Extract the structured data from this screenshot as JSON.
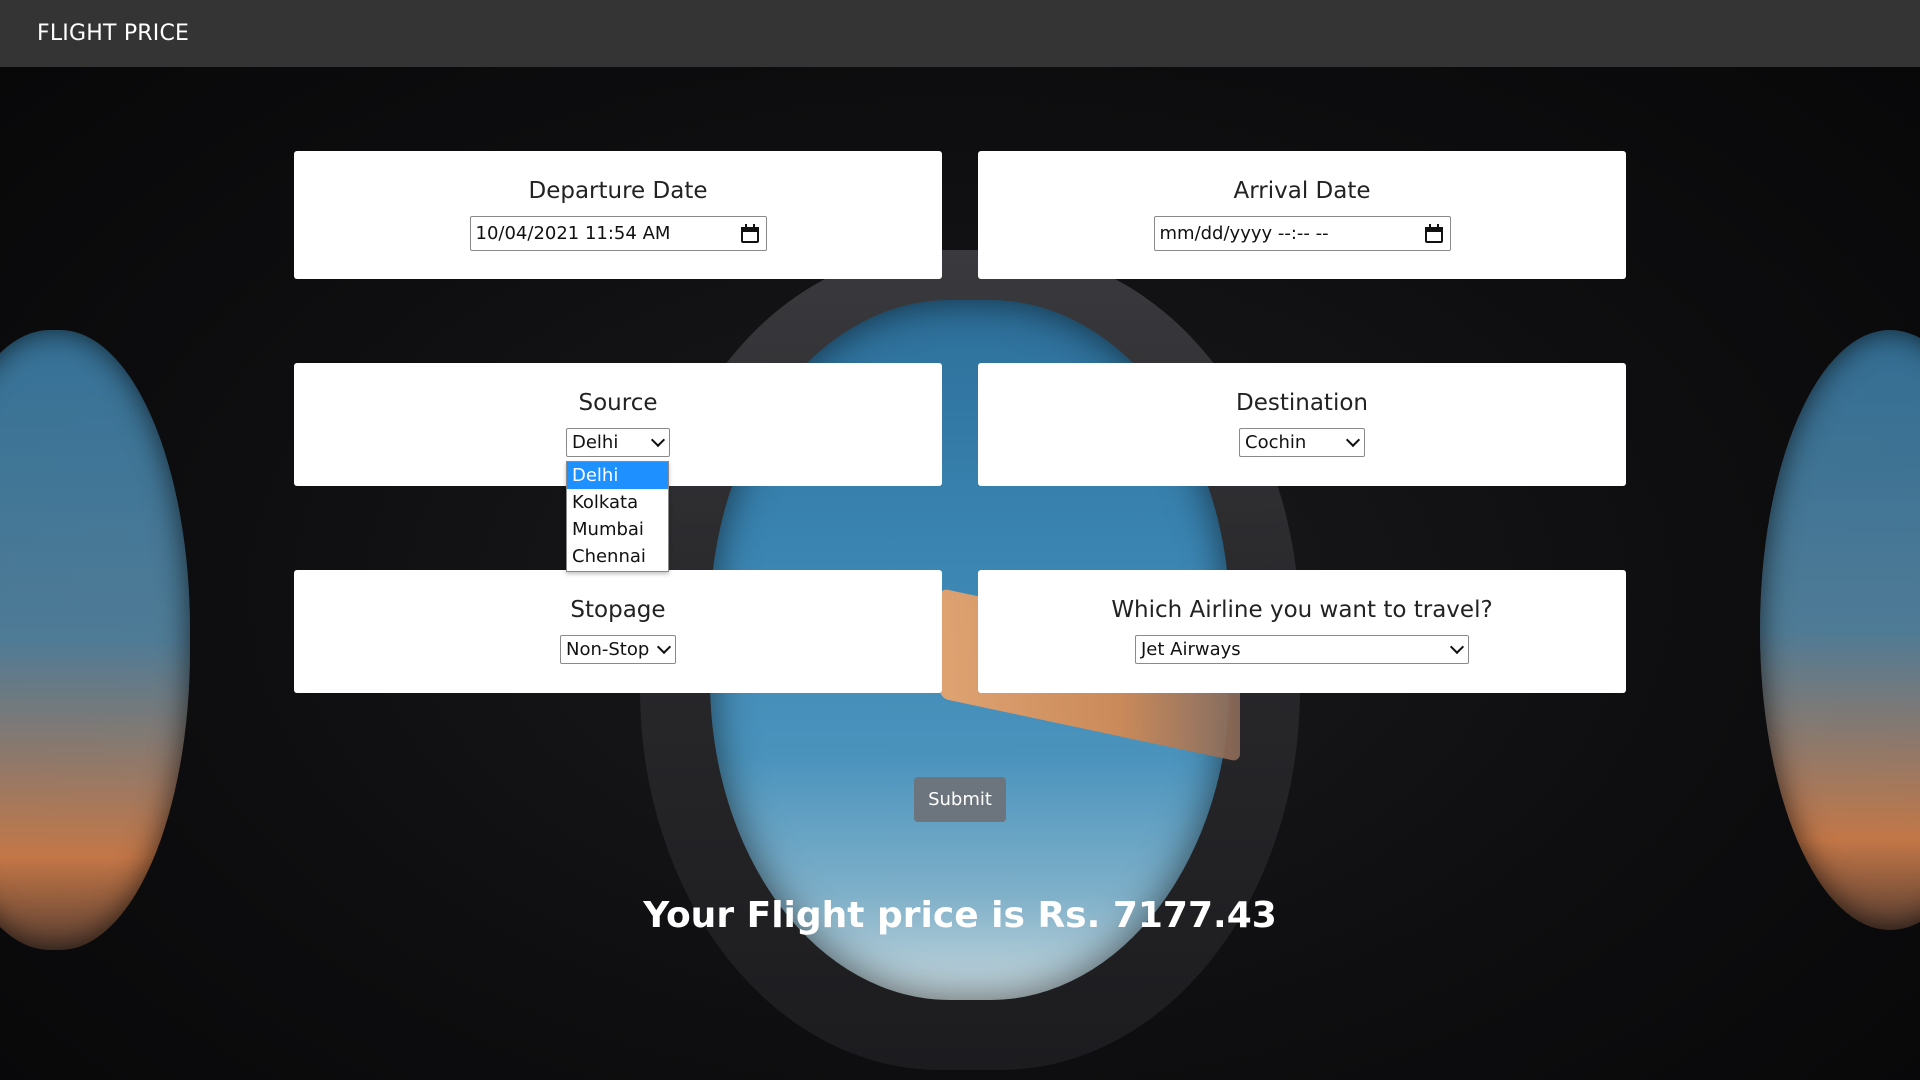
{
  "navbar": {
    "brand": "FLIGHT PRICE"
  },
  "departure": {
    "label": "Departure Date",
    "value": "10/04/2021 11:54 AM"
  },
  "arrival": {
    "label": "Arrival Date",
    "value": "mm/dd/yyyy --:-- --"
  },
  "source": {
    "label": "Source",
    "value": "Delhi",
    "options": [
      "Delhi",
      "Kolkata",
      "Mumbai",
      "Chennai"
    ]
  },
  "destination": {
    "label": "Destination",
    "value": "Cochin"
  },
  "stopage": {
    "label": "Stopage",
    "value": "Non-Stop"
  },
  "airline": {
    "label": "Which Airline you want to travel?",
    "value": "Jet Airways"
  },
  "submit_label": "Submit",
  "result_text": "Your Flight price is Rs. 7177.43",
  "colors": {
    "navbar": "#343434",
    "selected_option": "#1e90ff",
    "submit": "#6c757d"
  }
}
